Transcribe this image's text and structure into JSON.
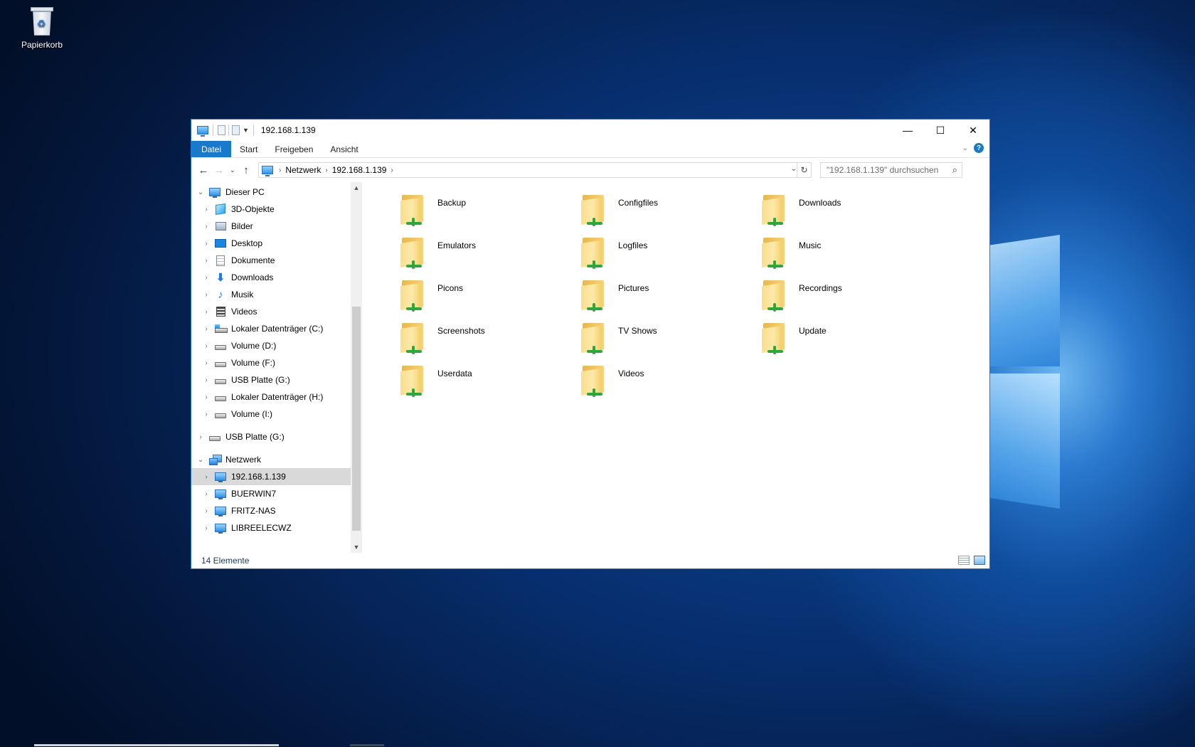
{
  "desktop": {
    "recycle_bin_label": "Papierkorb"
  },
  "window": {
    "title": "192.168.1.139",
    "controls": {
      "minimize": "—",
      "maximize": "☐",
      "close": "✕"
    }
  },
  "ribbon": {
    "tabs": [
      "Datei",
      "Start",
      "Freigeben",
      "Ansicht"
    ],
    "help": "?"
  },
  "address": {
    "crumbs": [
      "Netzwerk",
      "192.168.1.139"
    ],
    "search_placeholder": "\"192.168.1.139\" durchsuchen"
  },
  "nav_pane": {
    "this_pc": "Dieser PC",
    "this_pc_items": [
      "3D-Objekte",
      "Bilder",
      "Desktop",
      "Dokumente",
      "Downloads",
      "Musik",
      "Videos",
      "Lokaler Datenträger (C:)",
      "Volume (D:)",
      "Volume (F:)",
      "USB Platte (G:)",
      "Lokaler Datenträger (H:)",
      "Volume (I:)"
    ],
    "usb": "USB Platte (G:)",
    "network": "Netzwerk",
    "network_items": [
      "192.168.1.139",
      "BUERWIN7",
      "FRITZ-NAS",
      "LIBREELECWZ"
    ]
  },
  "folders": [
    "Backup",
    "Configfiles",
    "Downloads",
    "Emulators",
    "Logfiles",
    "Music",
    "Picons",
    "Pictures",
    "Recordings",
    "Screenshots",
    "TV Shows",
    "Update",
    "Userdata",
    "Videos"
  ],
  "status": {
    "count": "14 Elemente"
  }
}
